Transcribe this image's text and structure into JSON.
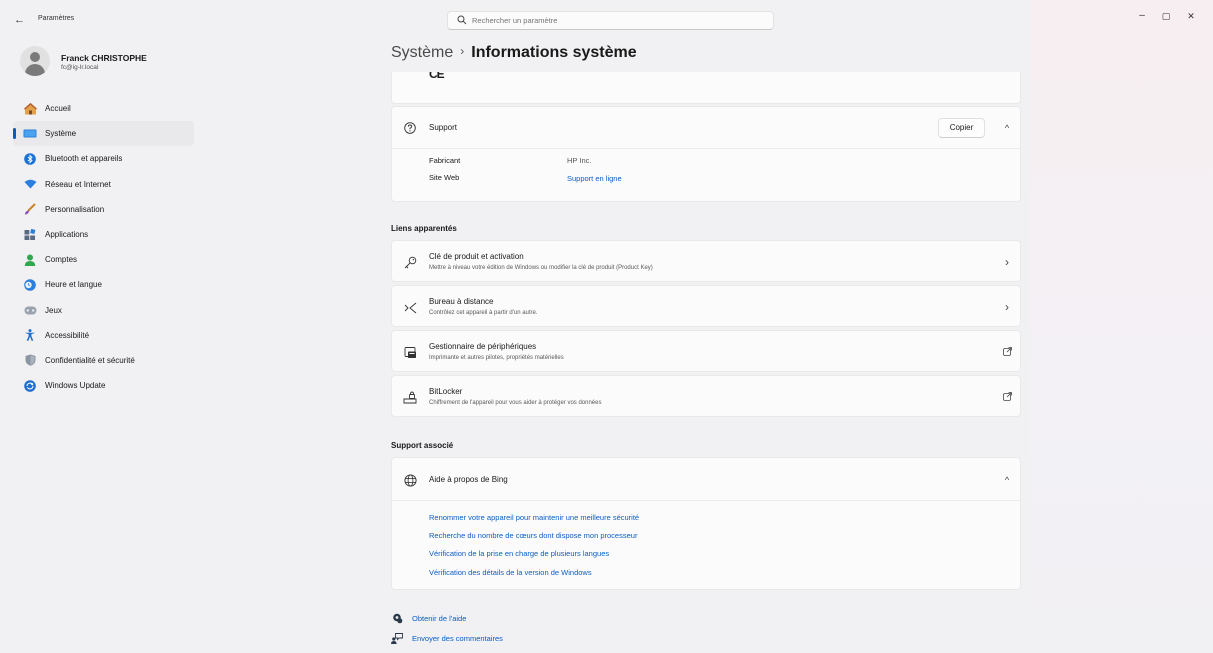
{
  "titlebar": {
    "back_glyph": "←",
    "app_title": "Paramètres",
    "search_placeholder": "Rechercher un paramètre",
    "minimize_glyph": "–",
    "maximize_glyph": "▢",
    "close_glyph": "✕"
  },
  "profile": {
    "name": "Franck CHRISTOPHE",
    "email": "fc@ig-lr.local"
  },
  "sidebar": {
    "items": [
      {
        "label": "Accueil",
        "icon": "home-icon"
      },
      {
        "label": "Système",
        "icon": "system-icon",
        "active": true
      },
      {
        "label": "Bluetooth et appareils",
        "icon": "bluetooth-icon"
      },
      {
        "label": "Réseau et Internet",
        "icon": "wifi-icon"
      },
      {
        "label": "Personnalisation",
        "icon": "brush-icon"
      },
      {
        "label": "Applications",
        "icon": "apps-icon"
      },
      {
        "label": "Comptes",
        "icon": "account-icon"
      },
      {
        "label": "Heure et langue",
        "icon": "clock-globe-icon"
      },
      {
        "label": "Jeux",
        "icon": "gamepad-icon"
      },
      {
        "label": "Accessibilité",
        "icon": "accessibility-icon"
      },
      {
        "label": "Confidentialité et sécurité",
        "icon": "shield-icon"
      },
      {
        "label": "Windows Update",
        "icon": "update-icon"
      }
    ]
  },
  "breadcrumb": {
    "parent": "Système",
    "separator": "›",
    "current": "Informations système"
  },
  "ce_mark": "CE",
  "support": {
    "title": "Support",
    "copy_label": "Copier",
    "collapse_glyph": "^",
    "rows": [
      {
        "label": "Fabricant",
        "value": "HP Inc."
      },
      {
        "label": "Site Web",
        "value": "Support en ligne"
      }
    ]
  },
  "related": {
    "title": "Liens apparentés",
    "items": [
      {
        "title": "Clé de produit et activation",
        "subtitle": "Mettre à niveau votre édition de Windows ou modifier la clé de produit (Product Key)",
        "icon": "key-icon",
        "action": "›"
      },
      {
        "title": "Bureau à distance",
        "subtitle": "Contrôlez cet appareil à partir d'un autre.",
        "icon": "remote-desktop-icon",
        "action": "›"
      },
      {
        "title": "Gestionnaire de périphériques",
        "subtitle": "Imprimante et autres pilotes, propriétés matérielles",
        "icon": "device-manager-icon",
        "action": "↗"
      },
      {
        "title": "BitLocker",
        "subtitle": "Chiffrement de l'appareil pour vous aider à protéger vos données",
        "icon": "bitlocker-icon",
        "action": "↗"
      }
    ]
  },
  "associated": {
    "title": "Support associé",
    "bing_title": "Aide à propos de Bing",
    "collapse_glyph": "^",
    "links": [
      "Renommer votre appareil pour maintenir une meilleure sécurité",
      "Recherche du nombre de cœurs dont dispose mon processeur",
      "Vérification de la prise en charge de plusieurs langues",
      "Vérification des détails de la version de Windows"
    ]
  },
  "footer": {
    "help": "Obtenir de l'aide",
    "feedback": "Envoyer des commentaires"
  },
  "colors": {
    "accent": "#005fb8",
    "link": "#0a5ec6"
  }
}
